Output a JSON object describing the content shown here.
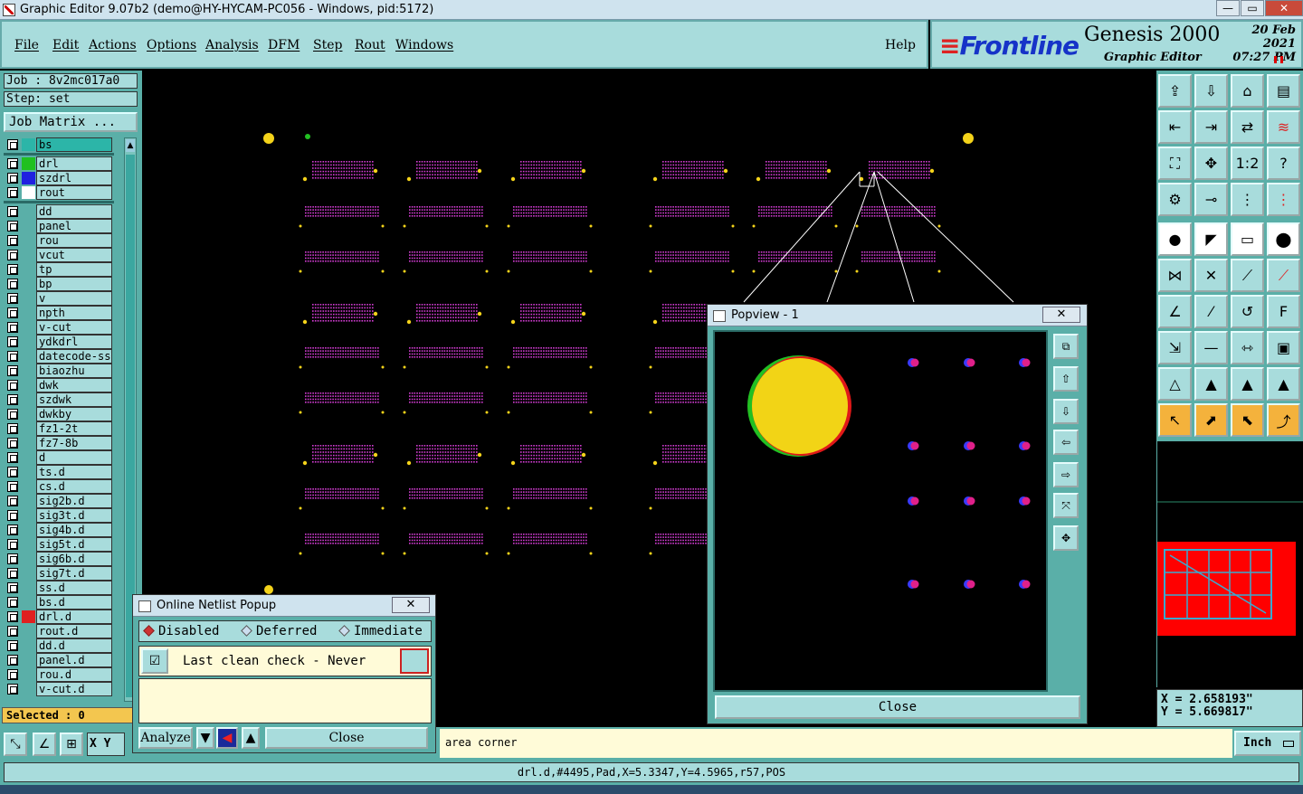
{
  "window": {
    "title": "Graphic Editor 9.07b2 (demo@HY-HYCAM-PC056 - Windows, pid:5172)",
    "controls": [
      "—",
      "▭",
      "✕"
    ]
  },
  "menu": {
    "items": [
      "File",
      "Edit",
      "Actions",
      "Options",
      "Analysis",
      "DFM",
      "Step",
      "Rout",
      "Windows"
    ],
    "help": "Help"
  },
  "brand": {
    "logo": "Frontline",
    "product": "Genesis 2000",
    "subtitle": "Graphic Editor",
    "date_line1": "20 Feb 2021",
    "date_line2": "07:27 PM"
  },
  "job": {
    "job_label": "Job : 8v2mc017a0",
    "step_label": "Step: set",
    "matrix_button": "Job Matrix ..."
  },
  "layers": [
    {
      "name": "bs",
      "color": "#2cb5a8",
      "highlight": true
    },
    {
      "name": "drl",
      "color": "#20c020",
      "highlight": false
    },
    {
      "name": "szdrl",
      "color": "#2020e0",
      "highlight": false
    },
    {
      "name": "rout",
      "color": "#ffffff",
      "highlight": false
    },
    {
      "name": "dd",
      "color": "",
      "highlight": false
    },
    {
      "name": "panel",
      "color": "",
      "highlight": false
    },
    {
      "name": "rou",
      "color": "",
      "highlight": false
    },
    {
      "name": "vcut",
      "color": "",
      "highlight": false
    },
    {
      "name": "tp",
      "color": "",
      "highlight": false
    },
    {
      "name": "bp",
      "color": "",
      "highlight": false
    },
    {
      "name": "v",
      "color": "",
      "highlight": false
    },
    {
      "name": "npth",
      "color": "",
      "highlight": false
    },
    {
      "name": "v-cut",
      "color": "",
      "highlight": false
    },
    {
      "name": "ydkdrl",
      "color": "",
      "highlight": false
    },
    {
      "name": "datecode-ss",
      "color": "",
      "highlight": false
    },
    {
      "name": "biaozhu",
      "color": "",
      "highlight": false
    },
    {
      "name": "dwk",
      "color": "",
      "highlight": false
    },
    {
      "name": "szdwk",
      "color": "",
      "highlight": false
    },
    {
      "name": "dwkby",
      "color": "",
      "highlight": false
    },
    {
      "name": "fz1-2t",
      "color": "",
      "highlight": false
    },
    {
      "name": "fz7-8b",
      "color": "",
      "highlight": false
    },
    {
      "name": "d",
      "color": "",
      "highlight": false
    },
    {
      "name": "ts.d",
      "color": "",
      "highlight": false
    },
    {
      "name": "cs.d",
      "color": "",
      "highlight": false
    },
    {
      "name": "sig2b.d",
      "color": "",
      "highlight": false
    },
    {
      "name": "sig3t.d",
      "color": "",
      "highlight": false
    },
    {
      "name": "sig4b.d",
      "color": "",
      "highlight": false
    },
    {
      "name": "sig5t.d",
      "color": "",
      "highlight": false
    },
    {
      "name": "sig6b.d",
      "color": "",
      "highlight": false
    },
    {
      "name": "sig7t.d",
      "color": "",
      "highlight": false
    },
    {
      "name": "ss.d",
      "color": "",
      "highlight": false
    },
    {
      "name": "bs.d",
      "color": "",
      "highlight": false
    },
    {
      "name": "drl.d",
      "color": "#e02020",
      "highlight": false
    },
    {
      "name": "rout.d",
      "color": "",
      "highlight": false
    },
    {
      "name": "dd.d",
      "color": "",
      "highlight": false
    },
    {
      "name": "panel.d",
      "color": "",
      "highlight": false
    },
    {
      "name": "rou.d",
      "color": "",
      "highlight": false
    },
    {
      "name": "v-cut.d",
      "color": "",
      "highlight": false
    }
  ],
  "selected": "Selected : 0",
  "coords": {
    "x": "X = 2.658193\"",
    "y": "Y = 5.669817\""
  },
  "status": {
    "xy_label": "X Y :",
    "prompt": "area corner",
    "units": "Inch",
    "message": "drl.d,#4495,Pad,X=5.3347,Y=4.5965,r57,POS"
  },
  "popview": {
    "title": "Popview - 1",
    "close": "Close"
  },
  "netlist": {
    "title": "Online Netlist Popup",
    "modes": [
      "Disabled",
      "Deferred",
      "Immediate"
    ],
    "selected_mode": "Disabled",
    "check_text": "Last clean check - Never",
    "analyze": "Analyze",
    "close": "Close"
  },
  "colors": {
    "panel_teal": "#5aafa8",
    "panel_light": "#a8dcdc",
    "pad_magenta": "#d23cd2",
    "pad_yellow": "#f4d31a",
    "overview_red": "#ff0000"
  }
}
